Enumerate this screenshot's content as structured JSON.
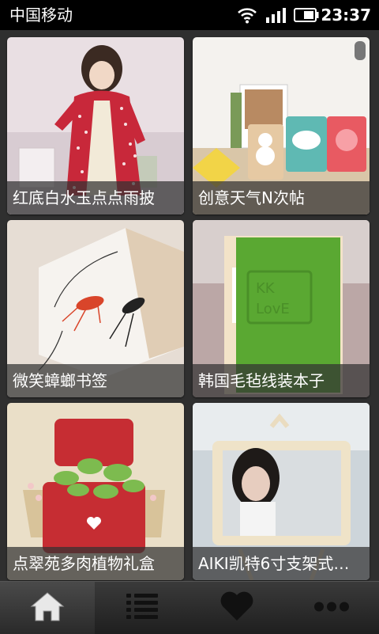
{
  "status_bar": {
    "carrier": "中国移动",
    "time": "23:37"
  },
  "items": [
    {
      "title": "红底白水玉点点雨披",
      "image": "woman-in-red-polka-dot-raincoat"
    },
    {
      "title": "创意天气N次帖",
      "image": "weather-sticky-notes-stands"
    },
    {
      "title": "微笑蟑螂书签",
      "image": "cockroach-bookmark-on-book"
    },
    {
      "title": "韩国毛毡线装本子",
      "image": "green-felt-notebook"
    },
    {
      "title": "点翠苑多肉植物礼盒",
      "image": "succulent-in-red-tin-box"
    },
    {
      "title": "AIKI凯特6寸支架式…",
      "image": "photo-frame-with-woman"
    }
  ],
  "tabbar": {
    "tabs": [
      {
        "icon": "home-icon",
        "active": true
      },
      {
        "icon": "list-icon",
        "active": false
      },
      {
        "icon": "heart-icon",
        "active": false
      },
      {
        "icon": "more-icon",
        "active": false
      }
    ]
  },
  "colors": {
    "caption_bg": "#323232",
    "status_bg": "#000000",
    "accent_red": "#c8283a",
    "felt_green": "#5aa832"
  }
}
